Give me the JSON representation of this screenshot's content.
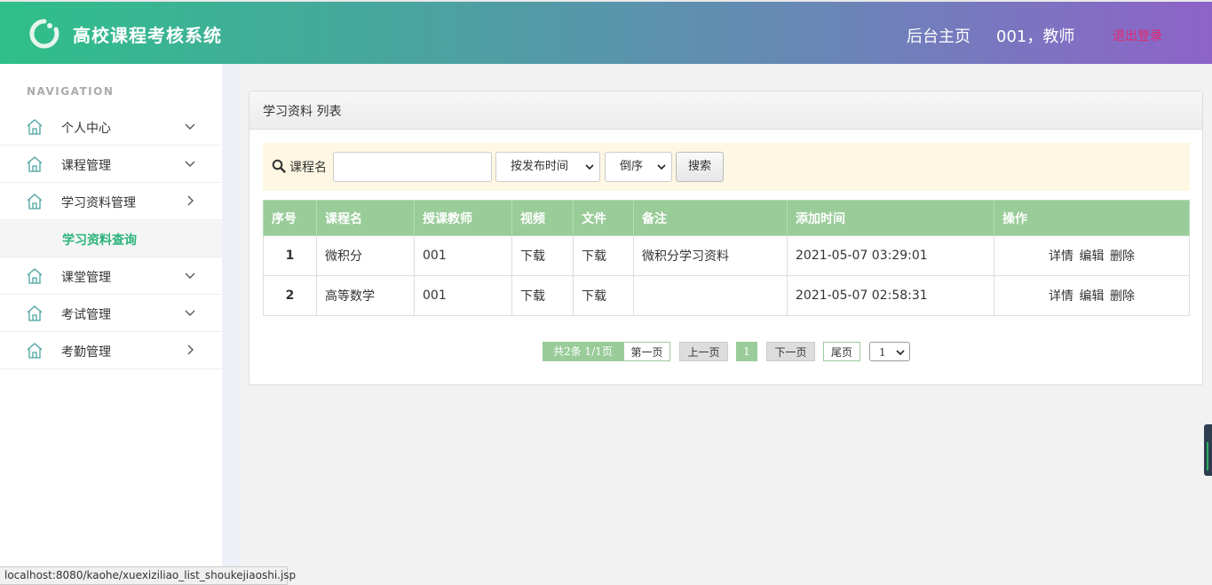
{
  "header": {
    "app_title": "高校课程考核系统",
    "home_link": "后台主页",
    "user": "001，教师",
    "logout": "退出登录"
  },
  "sidebar": {
    "heading": "NAVIGATION",
    "items": [
      {
        "label": "个人中心",
        "icon": "home-icon",
        "chevron": "chevron-down"
      },
      {
        "label": "课程管理",
        "icon": "home-icon",
        "chevron": "chevron-down"
      },
      {
        "label": "学习资料管理",
        "icon": "home-icon",
        "chevron": "chevron-right"
      },
      {
        "label": "课堂管理",
        "icon": "home-icon",
        "chevron": "chevron-down"
      },
      {
        "label": "考试管理",
        "icon": "home-icon",
        "chevron": "chevron-down"
      },
      {
        "label": "考勤管理",
        "icon": "home-icon",
        "chevron": "chevron-right"
      }
    ],
    "active_sub": "学习资料查询"
  },
  "panel": {
    "title": "学习资料 列表"
  },
  "search": {
    "label": "课程名",
    "value": "",
    "sort_field": "按发布时间",
    "sort_order": "倒序",
    "button": "搜索"
  },
  "table": {
    "columns": [
      "序号",
      "课程名",
      "授课教师",
      "视频",
      "文件",
      "备注",
      "添加时间",
      "操作"
    ],
    "rows": [
      {
        "no": "1",
        "course": "微积分",
        "teacher": "001",
        "video": "下载",
        "file": "下载",
        "note": "微积分学习资料",
        "time": "2021-05-07 03:29:01"
      },
      {
        "no": "2",
        "course": "高等数学",
        "teacher": "001",
        "video": "下载",
        "file": "下载",
        "note": "",
        "time": "2021-05-07 02:58:31"
      }
    ],
    "ops": {
      "detail": "详情",
      "edit": "编辑",
      "delete": "删除"
    }
  },
  "pagination": {
    "info": "共2条  1/1页",
    "first": "第一页",
    "prev": "上一页",
    "current": "1",
    "next": "下一页",
    "last": "尾页",
    "select": "1"
  },
  "statusbar": {
    "url": "localhost:8080/kaohe/xuexiziliao_list_shoukejiaoshi.jsp"
  },
  "colors": {
    "accent_green": "#99cc99",
    "active_text": "#2bb37a",
    "logout": "#e8266e"
  }
}
